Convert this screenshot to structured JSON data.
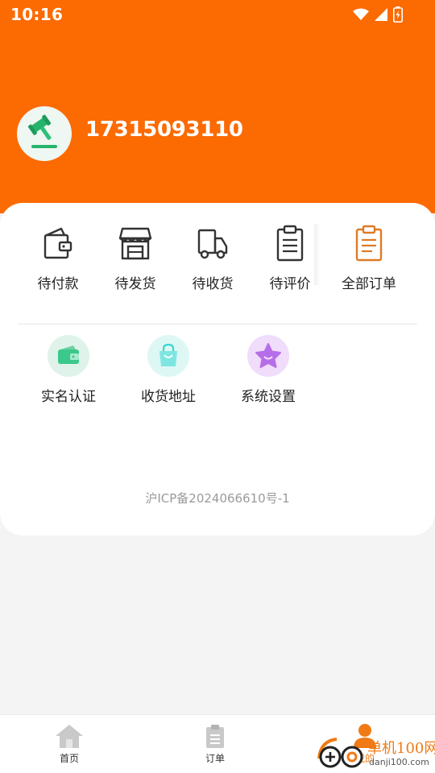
{
  "status_bar": {
    "time": "10:16"
  },
  "colors": {
    "brand": "#fc6a02",
    "accent_orange": "#e07a25",
    "green": "#22b36a",
    "purple": "#b66ee8",
    "teal": "#3ad6cf"
  },
  "profile": {
    "phone": "17315093110",
    "avatar_icon": "gavel-icon"
  },
  "orders": {
    "items": [
      {
        "label": "待付款",
        "icon": "wallet-icon"
      },
      {
        "label": "待发货",
        "icon": "shop-icon"
      },
      {
        "label": "待收货",
        "icon": "truck-icon"
      },
      {
        "label": "待评价",
        "icon": "clipboard-icon"
      },
      {
        "label": "全部订单",
        "icon": "clipboard-list-icon"
      }
    ]
  },
  "services": {
    "items": [
      {
        "label": "实名认证",
        "icon": "wallet-card-icon"
      },
      {
        "label": "收货地址",
        "icon": "shopping-bag-icon"
      },
      {
        "label": "系统设置",
        "icon": "star-icon"
      }
    ]
  },
  "footer": {
    "icp": "沪ICP备2024066610号-1"
  },
  "tabbar": {
    "items": [
      {
        "label": "首页",
        "icon": "home-icon"
      },
      {
        "label": "订单",
        "icon": "order-list-icon"
      },
      {
        "label": "我的",
        "icon": "user-icon"
      }
    ]
  },
  "watermark": {
    "text_cn": "单机100网",
    "text_url": "danji100.com"
  }
}
